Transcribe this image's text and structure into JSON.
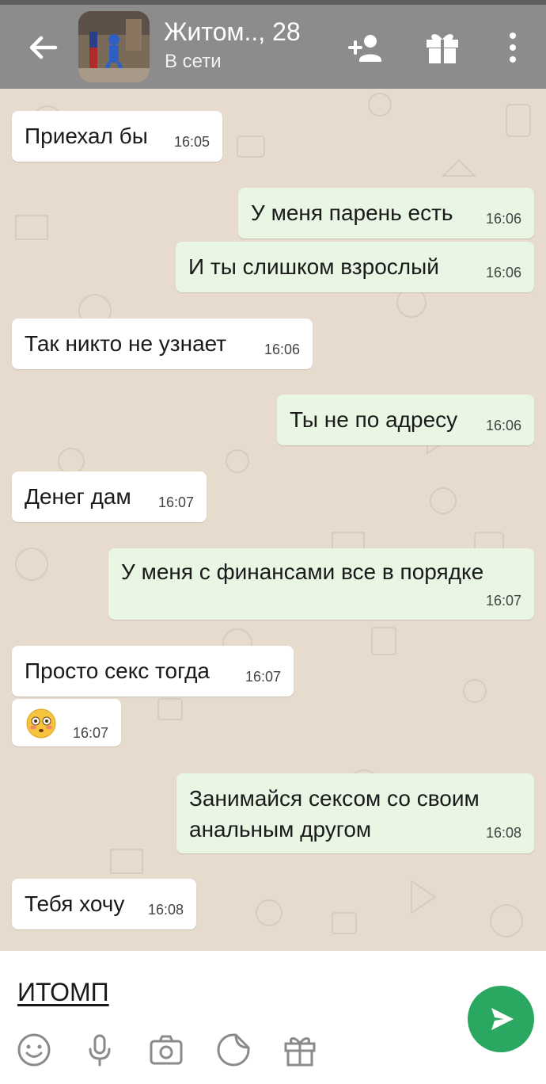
{
  "header": {
    "title": "Житом.., 28",
    "status": "В сети",
    "color": "#8c8c8c",
    "icons": [
      "arrow-left",
      "avatar-photo",
      "add-person",
      "gift",
      "more-vertical"
    ]
  },
  "messages": [
    {
      "dir": "in",
      "text": "Приехал бы",
      "time": "16:05"
    },
    {
      "dir": "out",
      "text": "У меня парень есть",
      "time": "16:06"
    },
    {
      "dir": "out",
      "text": "И ты слишком взрослый",
      "time": "16:06"
    },
    {
      "dir": "in",
      "text": "Так никто не узнает",
      "time": "16:06"
    },
    {
      "dir": "out",
      "text": "Ты не по адресу",
      "time": "16:06"
    },
    {
      "dir": "in",
      "text": "Денег дам",
      "time": "16:07"
    },
    {
      "dir": "out",
      "text": "У меня с финансами все в порядке",
      "time": "16:07"
    },
    {
      "dir": "in",
      "text": "Просто секс тогда",
      "time": "16:07"
    },
    {
      "dir": "in",
      "text": "😳",
      "time": "16:07"
    },
    {
      "dir": "out",
      "lines": [
        "Занимайся сексом со своим",
        "анальным другом"
      ],
      "time": "16:08"
    },
    {
      "dir": "in",
      "text": "Тебя хочу",
      "time": "16:08"
    }
  ],
  "colors": {
    "incoming": "#ffffff",
    "outgoing": "#e9f6e4",
    "background": "#e6dbcd",
    "send": "#2aa862"
  },
  "input": {
    "value": "ИТОМП",
    "bottom_icons": [
      "smile",
      "microphone",
      "camera",
      "sticker",
      "gift"
    ],
    "send_icon": "send"
  }
}
